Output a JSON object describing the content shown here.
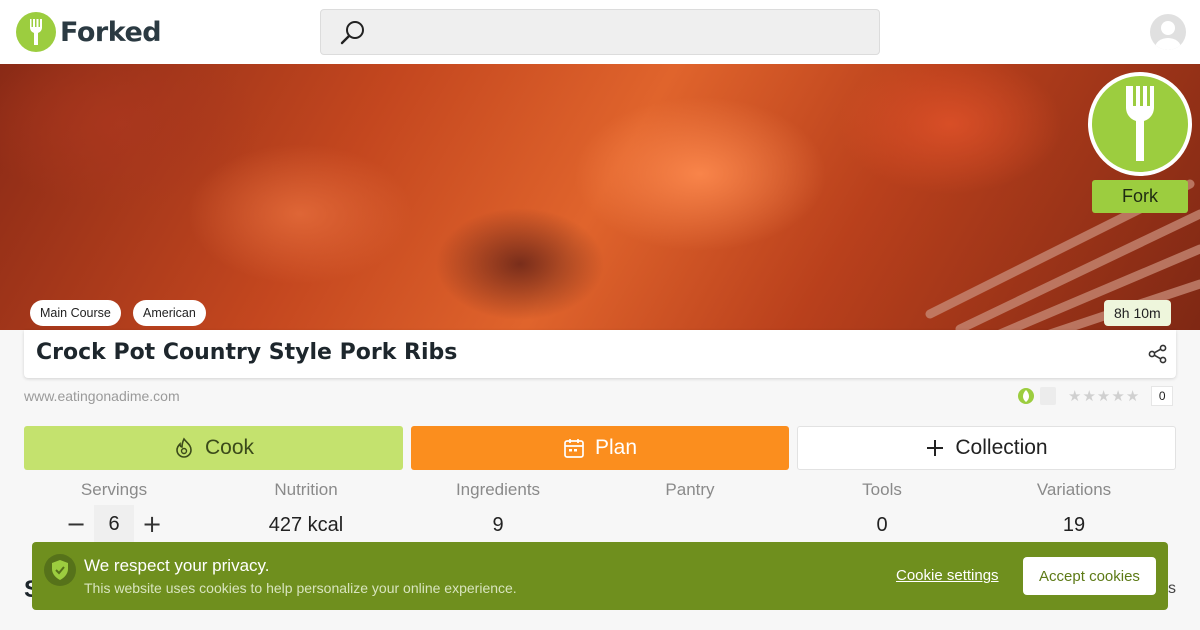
{
  "header": {
    "brand": "Forked",
    "search_placeholder": ""
  },
  "hero": {
    "fork_label": "Fork",
    "tags": [
      "Main Course",
      "American"
    ],
    "time": "8h 10m"
  },
  "recipe": {
    "title": "Crock Pot Country Style Pork Ribs",
    "source": "www.eatingonadime.com",
    "rating_count": "0",
    "stars": [
      "★",
      "★",
      "★",
      "★",
      "★"
    ]
  },
  "actions": {
    "cook": "Cook",
    "plan": "Plan",
    "collection": "Collection"
  },
  "stats": {
    "servings_label": "Servings",
    "servings_value": "6",
    "minus": "−",
    "plus": "+",
    "nutrition_label": "Nutrition",
    "nutrition_value": "427 kcal",
    "ingredients_label": "Ingredients",
    "ingredients_value": "9",
    "pantry_label": "Pantry",
    "pantry_value": "",
    "tools_label": "Tools",
    "tools_value": "0",
    "variations_label": "Variations",
    "variations_value": "19"
  },
  "cookie": {
    "title": "We respect your privacy.",
    "text": "This website uses cookies to help personalize your online experience.",
    "settings": "Cookie settings",
    "accept": "Accept cookies"
  },
  "behind": {
    "heading_initial": "S",
    "right_initial": "s"
  },
  "colors": {
    "brand_green": "#9ccd3f",
    "cook_green": "#c4e26e",
    "plan_orange": "#fb8e1e",
    "cookie_green": "#6f8f1e"
  }
}
